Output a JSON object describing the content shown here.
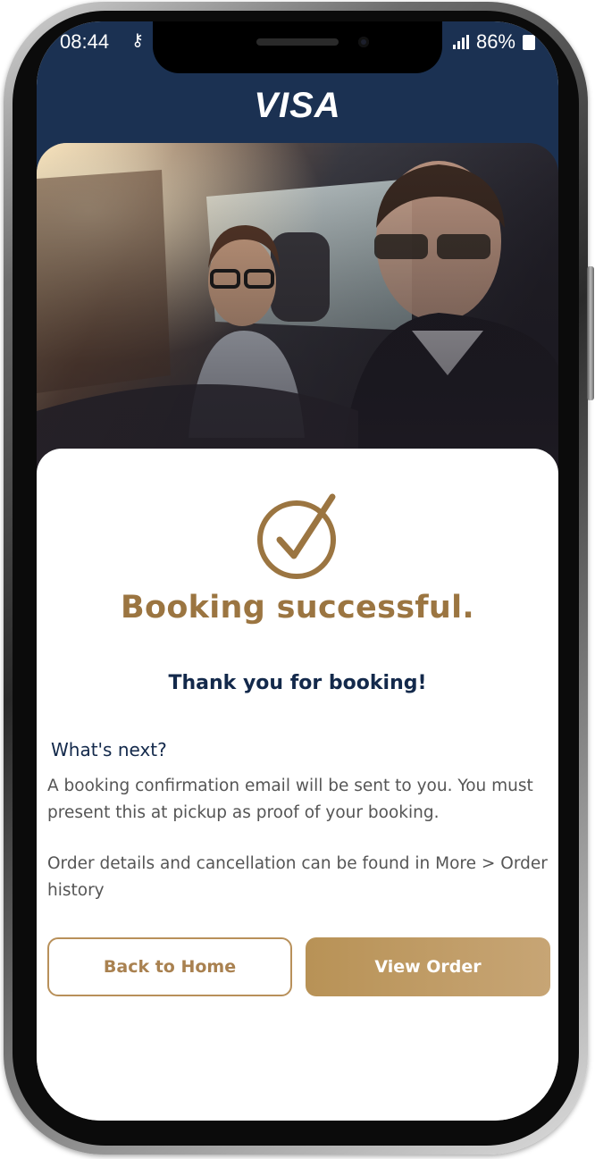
{
  "status_bar": {
    "time": "08:44",
    "key_icon": "key-icon",
    "battery_percent": "86%"
  },
  "header": {
    "logo_text": "VISA",
    "background": "#1b3152"
  },
  "hero": {
    "icon": "hero-photo"
  },
  "confirmation": {
    "check_icon": "check-circle-icon",
    "title": "Booking successful.",
    "thanks": "Thank you for booking!",
    "next_heading": "What's next?",
    "paragraph_1": "A booking confirmation email will be sent to you. You must present this at pickup as proof of your booking.",
    "paragraph_2": "Order details and cancellation can be found in More > Order history"
  },
  "buttons": {
    "back_home": "Back to Home",
    "view_order": "View Order"
  },
  "colors": {
    "gold": "#9b7541",
    "navy": "#13294b",
    "button_gold": "#c09b66"
  }
}
